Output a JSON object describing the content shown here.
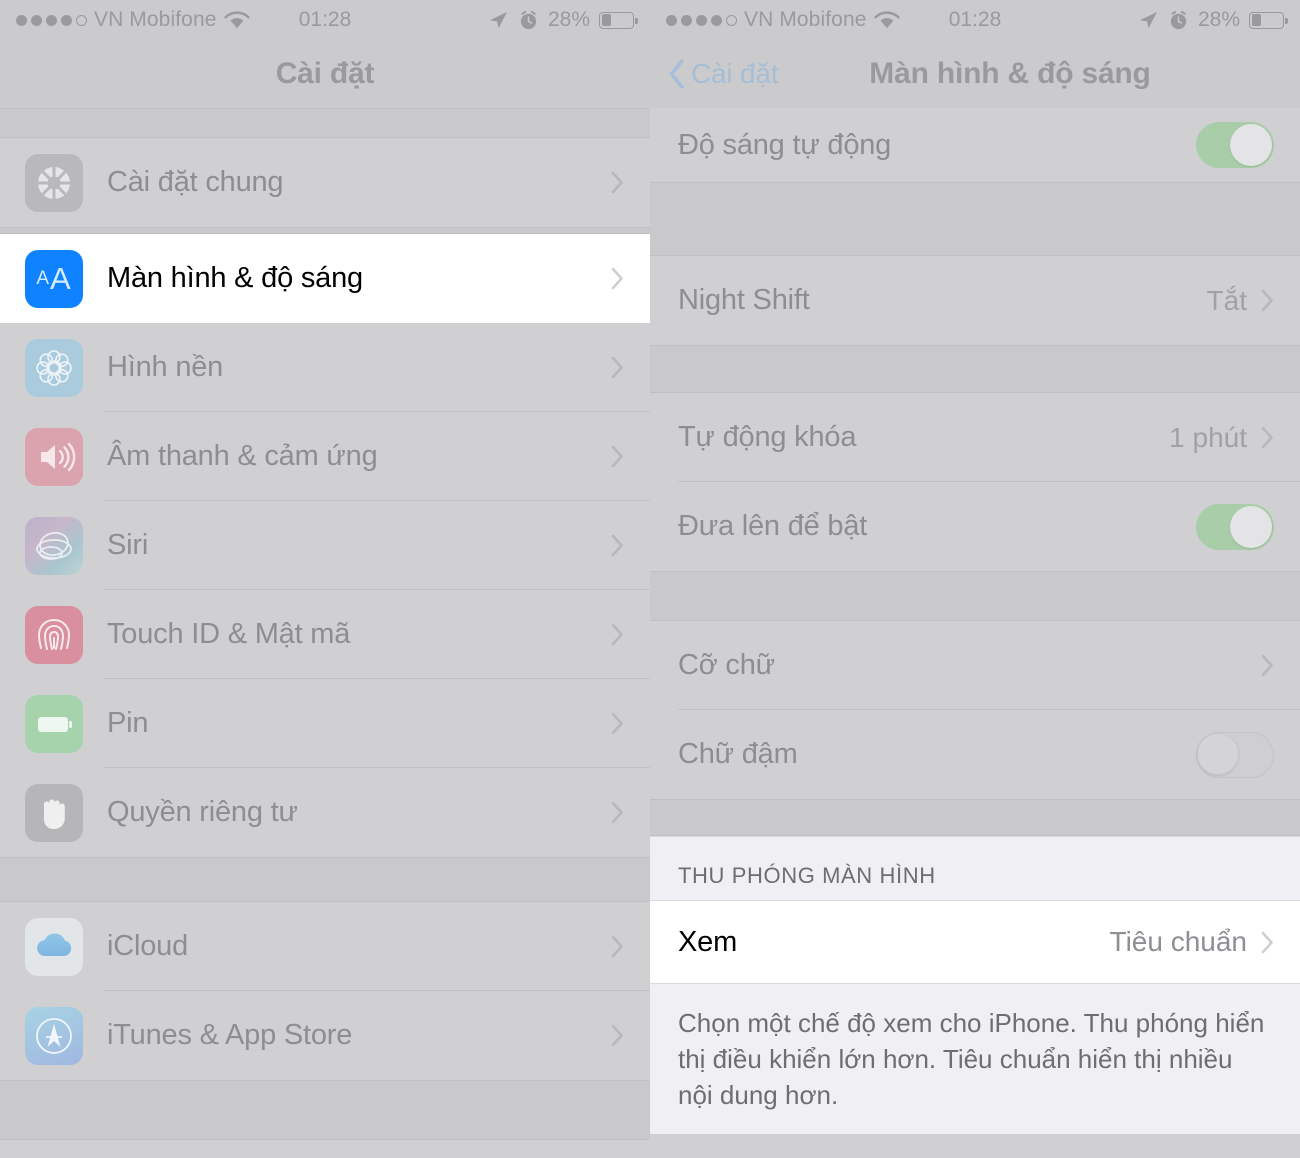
{
  "status_bar": {
    "signal_dots_filled": 4,
    "signal_dots_total": 5,
    "carrier": "VN Mobifone",
    "wifi_icon": "wifi-icon",
    "time": "01:28",
    "location_icon": "location-arrow-icon",
    "alarm_icon": "alarm-clock-icon",
    "battery_percent": "28%",
    "battery_level": 28
  },
  "left_panel": {
    "nav": {
      "title": "Cài đặt"
    },
    "groups": [
      {
        "items": [
          {
            "label": "Cài đặt chung",
            "icon": "gear-icon",
            "icon_class": "ic-gear",
            "highlighted": false
          }
        ]
      },
      {
        "items": [
          {
            "label": "Màn hình & độ sáng",
            "icon": "display-aa-icon",
            "icon_class": "ic-display",
            "highlighted": true
          },
          {
            "label": "Hình nền",
            "icon": "wallpaper-flower-icon",
            "icon_class": "ic-wallpaper",
            "highlighted": false
          },
          {
            "label": "Âm thanh & cảm ứng",
            "icon": "speaker-icon",
            "icon_class": "ic-sound",
            "highlighted": false
          },
          {
            "label": "Siri",
            "icon": "siri-waveform-icon",
            "icon_class": "ic-siri",
            "highlighted": false
          },
          {
            "label": "Touch ID & Mật mã",
            "icon": "fingerprint-icon",
            "icon_class": "ic-touchid",
            "highlighted": false
          },
          {
            "label": "Pin",
            "icon": "battery-icon",
            "icon_class": "ic-battery",
            "highlighted": false
          },
          {
            "label": "Quyền riêng tư",
            "icon": "hand-icon",
            "icon_class": "ic-privacy",
            "highlighted": false
          }
        ]
      },
      {
        "items": [
          {
            "label": "iCloud",
            "icon": "cloud-icon",
            "icon_class": "ic-icloud",
            "highlighted": false
          },
          {
            "label": "iTunes & App Store",
            "icon": "app-store-icon",
            "icon_class": "ic-appstore",
            "highlighted": false
          }
        ]
      }
    ]
  },
  "right_panel": {
    "nav": {
      "back_label": "Cài đặt",
      "back_icon": "chevron-left-icon",
      "title": "Màn hình & độ sáng"
    },
    "rows": {
      "auto_brightness": {
        "label": "Độ sáng tự động",
        "control": "toggle",
        "on": true
      },
      "night_shift": {
        "label": "Night Shift",
        "value": "Tắt",
        "control": "chevron"
      },
      "auto_lock": {
        "label": "Tự động khóa",
        "value": "1 phút",
        "control": "chevron"
      },
      "raise_to_wake": {
        "label": "Đưa lên để bật",
        "control": "toggle",
        "on": true
      },
      "text_size": {
        "label": "Cỡ chữ",
        "control": "chevron"
      },
      "bold_text": {
        "label": "Chữ đậm",
        "control": "toggle",
        "on": false
      }
    },
    "zoom_section": {
      "header": "THU PHÓNG MÀN HÌNH",
      "view_row": {
        "label": "Xem",
        "value": "Tiêu chuẩn"
      },
      "footer": "Chọn một chế độ xem cho iPhone. Thu phóng hiển thị điều khiển lớn hơn. Tiêu chuẩn hiển thị nhiều nội dung hơn."
    }
  },
  "colors": {
    "accent_blue": "#0f82ff",
    "link_blue": "#a5bede",
    "toggle_on_green": "#a8cda8",
    "dim_background": "#d0d0d2",
    "highlight_white": "#ffffff",
    "section_bg": "#efeff4"
  }
}
